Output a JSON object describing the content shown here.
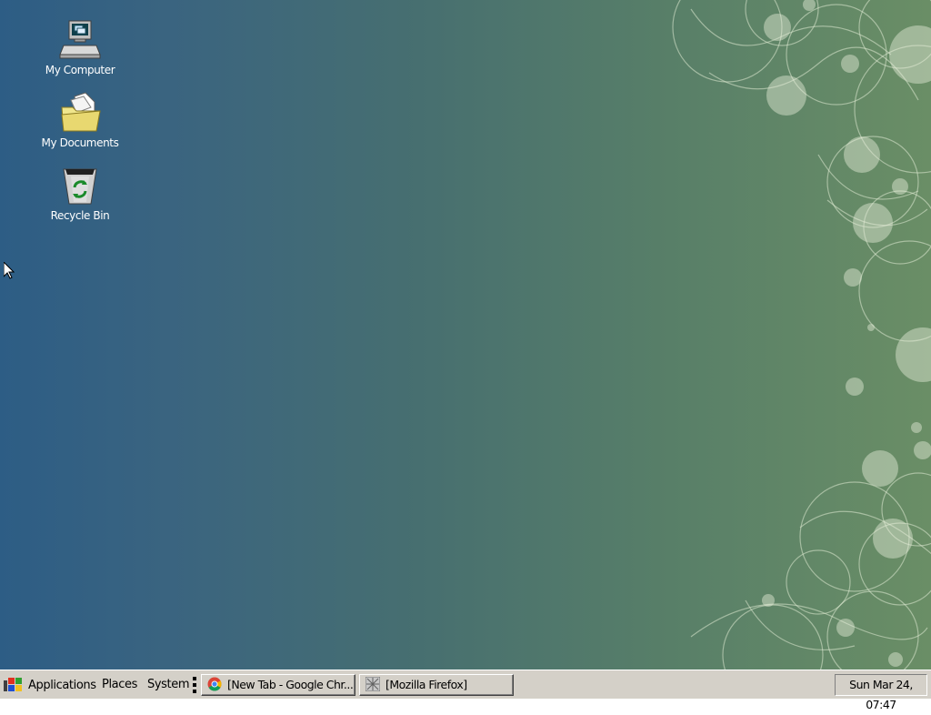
{
  "desktop": {
    "icons": [
      {
        "label": "My Computer",
        "icon": "computer-icon"
      },
      {
        "label": "My Documents",
        "icon": "folder-icon"
      },
      {
        "label": "Recycle Bin",
        "icon": "recycle-bin-icon"
      }
    ]
  },
  "taskbar": {
    "menus": {
      "applications": "Applications",
      "places": "Places",
      "system": "System"
    },
    "tasks": [
      {
        "label": "[New Tab - Google Chr...",
        "icon": "chrome-icon"
      },
      {
        "label": "[Mozilla Firefox]",
        "icon": "firefox-icon"
      }
    ],
    "clock": "Sun Mar 24, 07:47"
  },
  "colors": {
    "desktop_left": "#2d5d85",
    "desktop_right": "#6a8e66",
    "taskbar": "#d4d0c8"
  }
}
